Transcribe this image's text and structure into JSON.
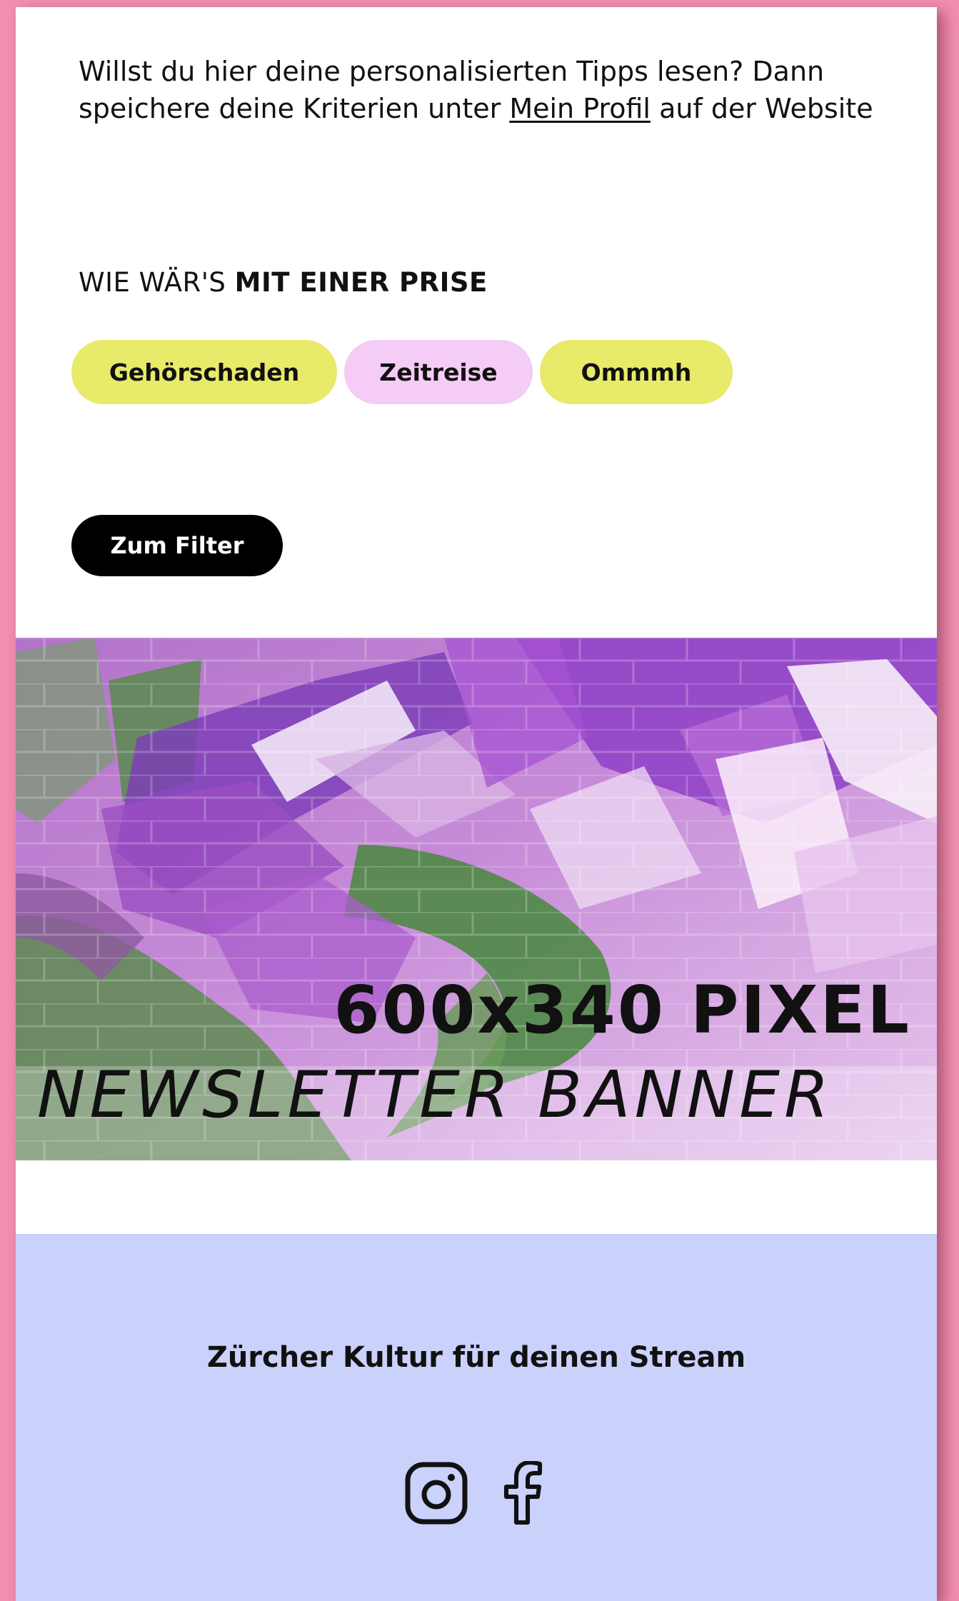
{
  "intro": {
    "text_before": "Willst du hier deine personalisierten Tipps lesen? Dann speichere deine Kriterien unter ",
    "link": "Mein Profil",
    "text_after": " auf der Website"
  },
  "prise": {
    "title_regular": "WIE WÄR'S ",
    "title_bold": "MIT EINER PRISE",
    "tags": [
      {
        "label": "Gehörschaden",
        "color": "#e8ea69"
      },
      {
        "label": "Zeitreise",
        "color": "#f4ccf5"
      },
      {
        "label": "Ommmh",
        "color": "#e8ea69"
      }
    ]
  },
  "filter_button": {
    "label": "Zum Filter",
    "color": "#000000"
  },
  "banner": {
    "line1": "600x340 PIXEL",
    "line2": "NEWSLETTER BANNER"
  },
  "footer": {
    "title": "Zürcher Kultur für deinen Stream",
    "background": "#cad1fa",
    "icons": [
      "instagram-icon",
      "facebook-icon"
    ]
  },
  "colors": {
    "page_background": "#f28eaf",
    "card_background": "#ffffff"
  }
}
